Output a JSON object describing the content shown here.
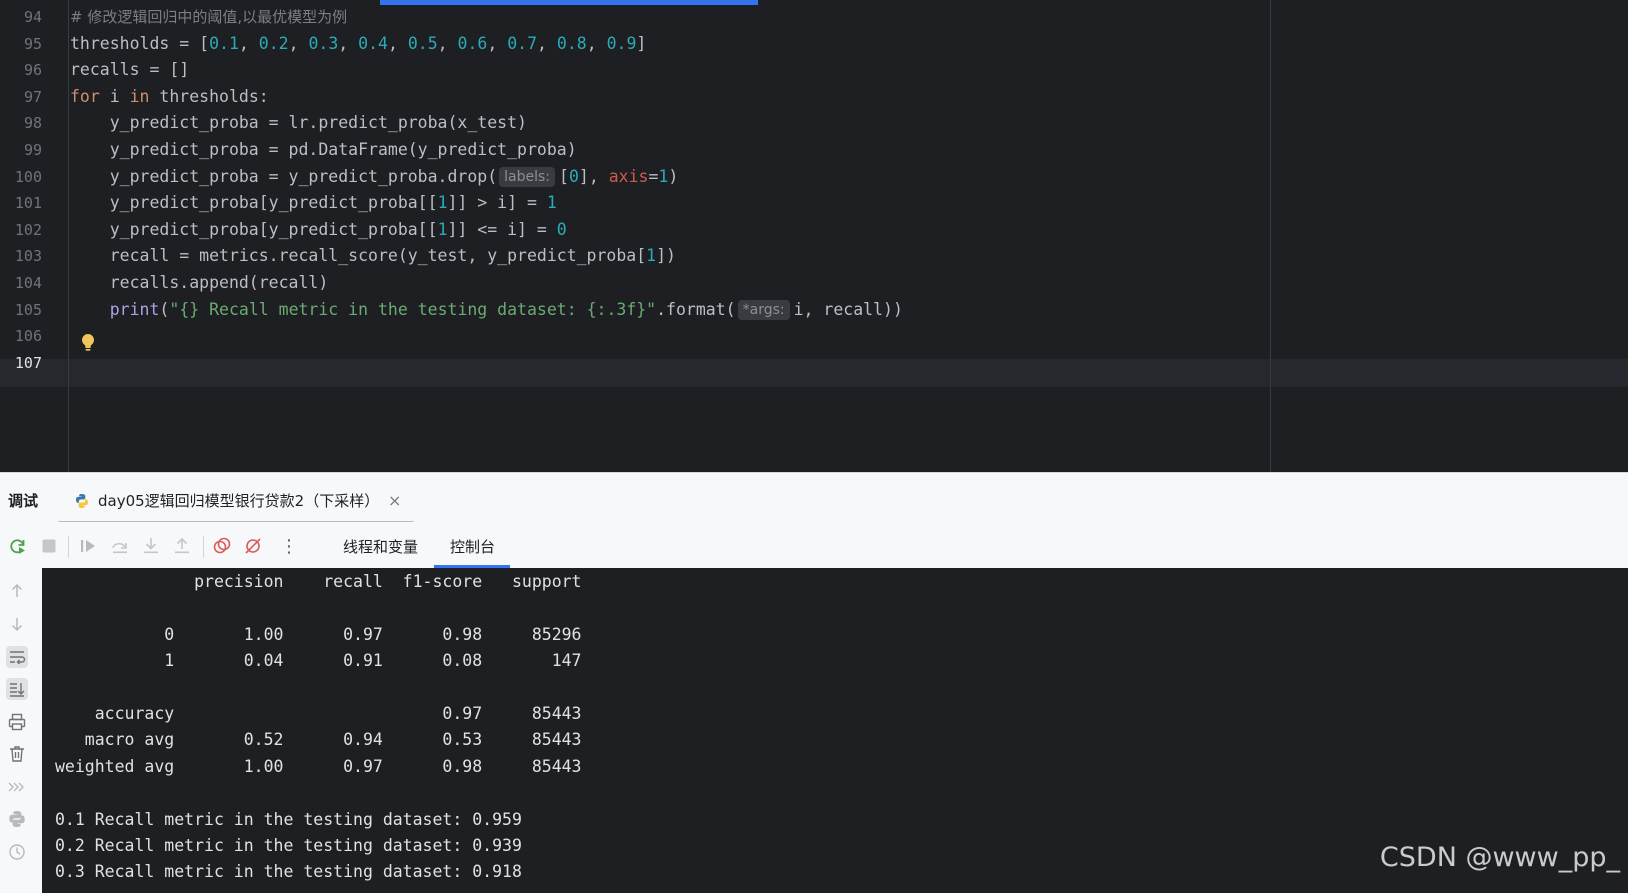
{
  "editor": {
    "line_numbers": [
      "94",
      "95",
      "96",
      "97",
      "98",
      "99",
      "100",
      "101",
      "102",
      "103",
      "104",
      "105",
      "106",
      "107"
    ],
    "lines": [
      [
        {
          "c": "cm",
          "t": "# 修改逻辑回归中的阈值,以最优模型为例"
        }
      ],
      [
        {
          "t": "thresholds = ["
        },
        {
          "c": "num",
          "t": "0.1"
        },
        {
          "t": ", "
        },
        {
          "c": "num",
          "t": "0.2"
        },
        {
          "t": ", "
        },
        {
          "c": "num",
          "t": "0.3"
        },
        {
          "t": ", "
        },
        {
          "c": "num",
          "t": "0.4"
        },
        {
          "t": ", "
        },
        {
          "c": "num",
          "t": "0.5"
        },
        {
          "t": ", "
        },
        {
          "c": "num",
          "t": "0.6"
        },
        {
          "t": ", "
        },
        {
          "c": "num",
          "t": "0.7"
        },
        {
          "t": ", "
        },
        {
          "c": "num",
          "t": "0.8"
        },
        {
          "t": ", "
        },
        {
          "c": "num",
          "t": "0.9"
        },
        {
          "t": "]"
        }
      ],
      [
        {
          "t": "recalls = []"
        }
      ],
      [
        {
          "c": "kw",
          "t": "for"
        },
        {
          "t": " i "
        },
        {
          "c": "kw",
          "t": "in"
        },
        {
          "t": " thresholds:"
        }
      ],
      [
        {
          "t": "    y_predict_proba = lr.predict_proba(x_test)"
        }
      ],
      [
        {
          "t": "    y_predict_proba = pd.DataFrame(y_predict_proba)"
        }
      ],
      [
        {
          "t": "    y_predict_proba = y_predict_proba.drop("
        },
        {
          "c": "hint",
          "t": "labels:"
        },
        {
          "t": "["
        },
        {
          "c": "num",
          "t": "0"
        },
        {
          "t": "], "
        },
        {
          "c": "kwarg",
          "t": "axis"
        },
        {
          "t": "="
        },
        {
          "c": "num",
          "t": "1"
        },
        {
          "t": ")"
        }
      ],
      [
        {
          "t": "    y_predict_proba[y_predict_proba[["
        },
        {
          "c": "num",
          "t": "1"
        },
        {
          "t": "]] > i] = "
        },
        {
          "c": "num",
          "t": "1"
        }
      ],
      [
        {
          "t": "    y_predict_proba[y_predict_proba[["
        },
        {
          "c": "num",
          "t": "1"
        },
        {
          "t": "]] <= i] = "
        },
        {
          "c": "num",
          "t": "0"
        }
      ],
      [
        {
          "t": "    recall = metrics.recall_score(y_test, y_predict_proba["
        },
        {
          "c": "num",
          "t": "1"
        },
        {
          "t": "])"
        }
      ],
      [
        {
          "t": "    recalls.append(recall)"
        }
      ],
      [
        {
          "t": "    "
        },
        {
          "c": "fn",
          "t": "print"
        },
        {
          "t": "("
        },
        {
          "c": "str",
          "t": "\"{} Recall metric in the testing dataset: {:.3f}\""
        },
        {
          "t": ".format("
        },
        {
          "c": "hint",
          "t": "*args:"
        },
        {
          "t": "i, recall))"
        }
      ],
      [],
      []
    ],
    "current_line": "107"
  },
  "tool_window": {
    "title": "调试",
    "run_tab_label": "day05逻辑回归模型银行贷款2（下采样）",
    "close_glyph": "×",
    "tabs": {
      "threads": "线程和变量",
      "console": "控制台"
    },
    "more_glyph": "⋮"
  },
  "console": {
    "lines": [
      "              precision    recall  f1-score   support",
      "",
      "           0       1.00      0.97      0.98     85296",
      "           1       0.04      0.91      0.08       147",
      "",
      "    accuracy                           0.97     85443",
      "   macro avg       0.52      0.94      0.53     85443",
      "weighted avg       1.00      0.97      0.98     85443",
      "",
      "0.1 Recall metric in the testing dataset: 0.959",
      "0.2 Recall metric in the testing dataset: 0.939",
      "0.3 Recall metric in the testing dataset: 0.918"
    ]
  },
  "watermark": "CSDN @www_pp_",
  "colors": {
    "editor_bg": "#1e1f22",
    "keyword": "#cf8e6d",
    "number": "#2aacb8",
    "string": "#6aab73",
    "comment": "#7a7e85",
    "accent": "#3574f0",
    "rerun": "#4da34d",
    "breakpoint": "#db5c5c"
  }
}
